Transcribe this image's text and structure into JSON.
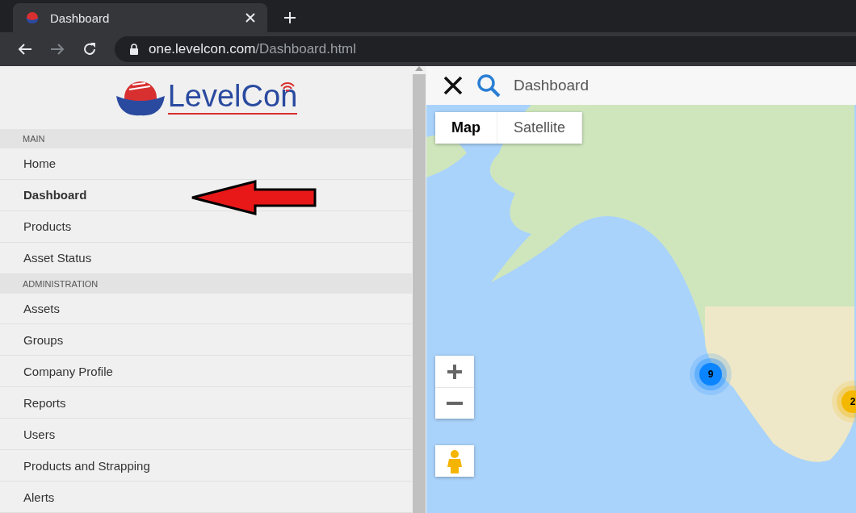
{
  "browser": {
    "tab_title": "Dashboard",
    "url_host": "one.levelcon.com",
    "url_path": "/Dashboard.html"
  },
  "logo": {
    "text": "LevelCon"
  },
  "sidebar": {
    "sections": [
      {
        "header": "MAIN",
        "items": [
          {
            "label": "Home",
            "selected": false
          },
          {
            "label": "Dashboard",
            "selected": true
          },
          {
            "label": "Products",
            "selected": false
          },
          {
            "label": "Asset Status",
            "selected": false
          }
        ]
      },
      {
        "header": "ADMINISTRATION",
        "items": [
          {
            "label": "Assets",
            "selected": false
          },
          {
            "label": "Groups",
            "selected": false
          },
          {
            "label": "Company Profile",
            "selected": false
          },
          {
            "label": "Reports",
            "selected": false
          },
          {
            "label": "Users",
            "selected": false
          },
          {
            "label": "Products and Strapping",
            "selected": false
          },
          {
            "label": "Alerts",
            "selected": false
          }
        ]
      }
    ]
  },
  "topbar": {
    "title": "Dashboard"
  },
  "map": {
    "types": [
      {
        "label": "Map",
        "selected": true
      },
      {
        "label": "Satellite",
        "selected": false
      }
    ],
    "clusters": [
      {
        "count": "9",
        "color": "#0a84ff"
      },
      {
        "count": "2",
        "color": "#f5b800"
      }
    ]
  }
}
